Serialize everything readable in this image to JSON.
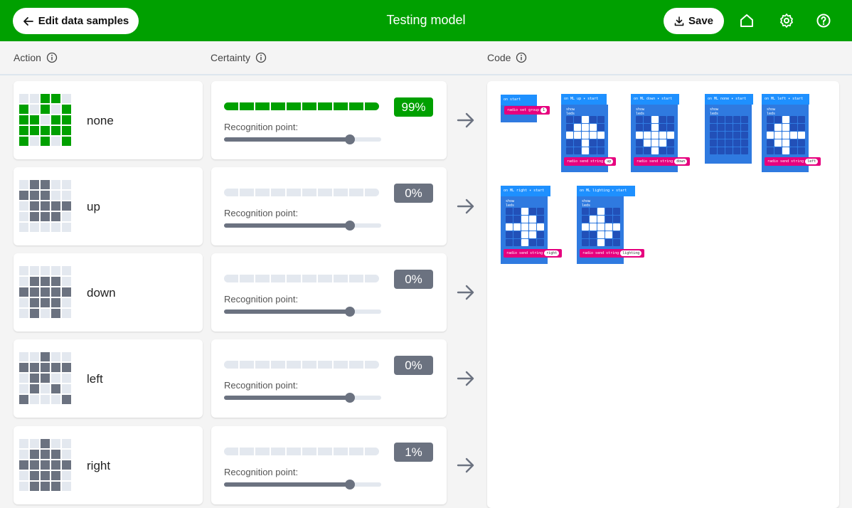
{
  "header": {
    "back_label": "Edit data samples",
    "title": "Testing model",
    "save_label": "Save",
    "icons": [
      "home-icon",
      "settings-icon",
      "help-icon"
    ],
    "color": "#00a000"
  },
  "columns": {
    "action": "Action",
    "certainty": "Certainty",
    "code": "Code"
  },
  "rec_label": "Recognition point:",
  "actions": [
    {
      "name": "none",
      "certainty": "99%",
      "certainty_value": 0.99,
      "recognition_point": 0.8,
      "leds": [
        0,
        0,
        1,
        1,
        0,
        1,
        0,
        1,
        0,
        1,
        1,
        1,
        0,
        1,
        1,
        1,
        1,
        1,
        1,
        1,
        1,
        0,
        1,
        0,
        1
      ]
    },
    {
      "name": "up",
      "certainty": "0%",
      "certainty_value": 0.0,
      "recognition_point": 0.8,
      "leds": [
        0,
        1,
        1,
        0,
        0,
        1,
        1,
        1,
        0,
        0,
        0,
        1,
        1,
        1,
        1,
        0,
        1,
        1,
        1,
        0,
        0,
        0,
        0,
        0,
        0
      ]
    },
    {
      "name": "down",
      "certainty": "0%",
      "certainty_value": 0.0,
      "recognition_point": 0.8,
      "leds": [
        0,
        0,
        0,
        0,
        0,
        0,
        1,
        1,
        1,
        0,
        1,
        1,
        1,
        1,
        1,
        0,
        1,
        1,
        1,
        0,
        0,
        1,
        0,
        1,
        0
      ]
    },
    {
      "name": "left",
      "certainty": "0%",
      "certainty_value": 0.0,
      "recognition_point": 0.8,
      "leds": [
        0,
        0,
        1,
        0,
        0,
        1,
        1,
        1,
        1,
        1,
        0,
        1,
        1,
        0,
        0,
        0,
        1,
        0,
        1,
        0,
        1,
        0,
        0,
        0,
        1
      ]
    },
    {
      "name": "right",
      "certainty": "1%",
      "certainty_value": 0.01,
      "recognition_point": 0.8,
      "leds": [
        0,
        0,
        1,
        0,
        0,
        0,
        1,
        1,
        1,
        0,
        1,
        1,
        1,
        1,
        1,
        0,
        1,
        1,
        1,
        0,
        0,
        1,
        1,
        1,
        0
      ]
    }
  ],
  "code_blocks": {
    "on_start": "on start",
    "radio_set_group": "radio set group",
    "radio_group_value": "1",
    "show_leds": "show leds",
    "radio_send_string": "radio send string",
    "ml_events": [
      {
        "label": "on ML  up ▾  start",
        "string": "up",
        "leds": [
          0,
          0,
          1,
          0,
          0,
          0,
          1,
          1,
          1,
          0,
          1,
          1,
          1,
          1,
          1,
          0,
          0,
          1,
          0,
          0,
          0,
          0,
          1,
          0,
          0
        ]
      },
      {
        "label": "on ML  down ▾  start",
        "string": "down",
        "leds": [
          0,
          0,
          1,
          0,
          0,
          0,
          0,
          1,
          0,
          0,
          1,
          1,
          1,
          1,
          1,
          0,
          1,
          1,
          1,
          0,
          0,
          0,
          1,
          0,
          0
        ]
      },
      {
        "label": "on ML  none ▾  start",
        "string": "",
        "leds": [
          0,
          0,
          0,
          0,
          0,
          0,
          0,
          0,
          0,
          0,
          0,
          0,
          0,
          0,
          0,
          0,
          0,
          0,
          0,
          0,
          0,
          0,
          0,
          0,
          0
        ]
      },
      {
        "label": "on ML  left ▾  start",
        "string": "left",
        "leds": [
          0,
          0,
          1,
          0,
          0,
          0,
          1,
          1,
          0,
          0,
          1,
          1,
          1,
          1,
          1,
          0,
          1,
          1,
          0,
          0,
          0,
          0,
          1,
          0,
          0
        ]
      },
      {
        "label": "on ML  right ▾  start",
        "string": "right",
        "leds": [
          0,
          0,
          1,
          0,
          0,
          0,
          0,
          1,
          1,
          0,
          1,
          1,
          1,
          1,
          1,
          0,
          0,
          1,
          1,
          0,
          0,
          0,
          1,
          0,
          0
        ]
      },
      {
        "label": "on ML  lighting ▾  start",
        "string": "lighting",
        "leds": [
          0,
          0,
          1,
          0,
          0,
          0,
          1,
          1,
          0,
          0,
          1,
          1,
          1,
          1,
          1,
          0,
          0,
          1,
          1,
          0,
          0,
          0,
          1,
          0,
          0
        ]
      }
    ]
  }
}
